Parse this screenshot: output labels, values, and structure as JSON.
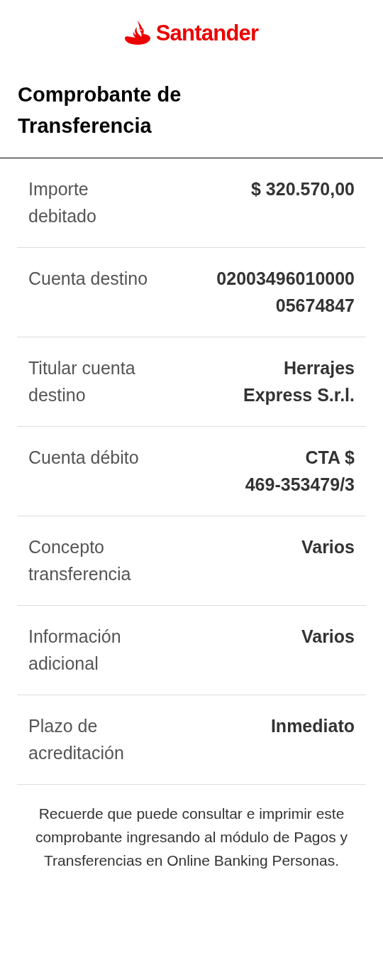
{
  "header": {
    "brand": "Santander"
  },
  "title": "Comprobante de\nTransferencia",
  "rows": [
    {
      "label": "Importe\ndebitado",
      "value": "$ 320.570,00"
    },
    {
      "label": "Cuenta destino",
      "value": "02003496010000\n05674847"
    },
    {
      "label": "Titular cuenta\ndestino",
      "value": "Herrajes\nExpress S.r.l."
    },
    {
      "label": "Cuenta débito",
      "value": "CTA $\n469-353479/3"
    },
    {
      "label": "Concepto\ntransferencia",
      "value": "Varios"
    },
    {
      "label": "Información\nadicional",
      "value": "Varios"
    },
    {
      "label": "Plazo de\nacreditación",
      "value": "Inmediato"
    }
  ],
  "footer_note": "Recuerde que puede consultar e imprimir este comprobante ingresando al módulo de Pagos y Transferencias en Online Banking Personas."
}
